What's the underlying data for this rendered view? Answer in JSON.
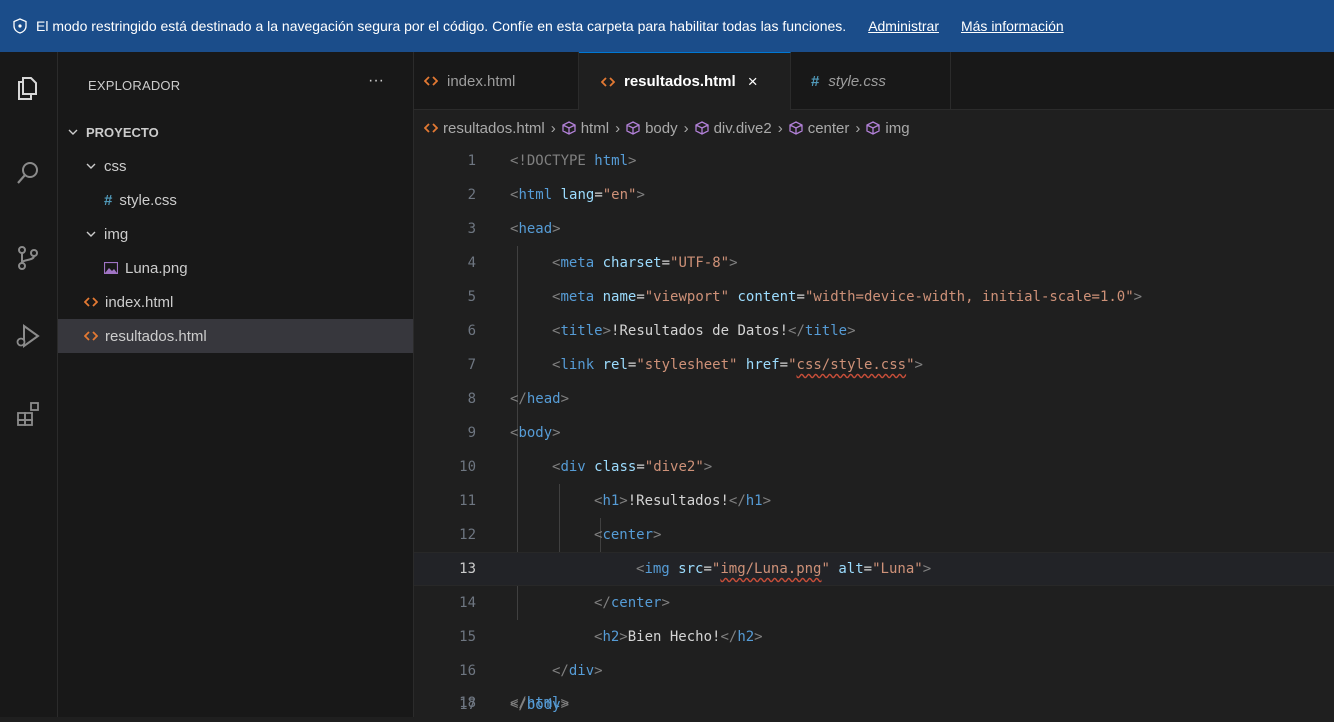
{
  "banner": {
    "message": "El modo restringido está destinado a la navegación segura por el código. Confíe en esta carpeta para habilitar todas las funciones.",
    "manage_label": "Administrar",
    "more_info_label": "Más información"
  },
  "sidebar": {
    "title": "EXPLORADOR",
    "more": "···",
    "project": "PROYECTO",
    "items": [
      {
        "label": "css"
      },
      {
        "label": "style.css"
      },
      {
        "label": "img"
      },
      {
        "label": "Luna.png"
      },
      {
        "label": "index.html"
      },
      {
        "label": "resultados.html"
      }
    ]
  },
  "tabs": [
    {
      "label": "index.html"
    },
    {
      "label": "resultados.html",
      "close": "×"
    },
    {
      "label": "style.css"
    }
  ],
  "breadcrumb": [
    "resultados.html",
    "html",
    "body",
    "div.dive2",
    "center",
    "img"
  ],
  "editor": {
    "current_line": 13,
    "lines": [
      {
        "n": "1"
      },
      {
        "n": "2"
      },
      {
        "n": "3"
      },
      {
        "n": "4"
      },
      {
        "n": "5"
      },
      {
        "n": "6"
      },
      {
        "n": "7"
      },
      {
        "n": "8"
      },
      {
        "n": "9"
      },
      {
        "n": "10"
      },
      {
        "n": "11"
      },
      {
        "n": "12"
      },
      {
        "n": "13"
      },
      {
        "n": "14"
      },
      {
        "n": "15"
      },
      {
        "n": "16"
      },
      {
        "n": "17"
      },
      {
        "n": "18"
      }
    ],
    "code": {
      "l1": [
        "<!DOCTYPE ",
        "html",
        ">"
      ],
      "l2": [
        "<",
        "html",
        " ",
        "lang",
        "=",
        "\"en\"",
        ">"
      ],
      "l3": [
        "<",
        "head",
        ">"
      ],
      "l4": [
        "<",
        "meta",
        " ",
        "charset",
        "=",
        "\"UTF-8\"",
        ">"
      ],
      "l5": [
        "<",
        "meta",
        " ",
        "name",
        "=",
        "\"viewport\"",
        " ",
        "content",
        "=",
        "\"width=device-width, initial-scale=1.0\"",
        ">"
      ],
      "l6": [
        "<",
        "title",
        ">",
        "!Resultados de Datos!",
        "</",
        "title",
        ">"
      ],
      "l7": [
        "<",
        "link",
        " ",
        "rel",
        "=",
        "\"stylesheet\"",
        " ",
        "href",
        "=",
        "\"",
        "css/style.css",
        "\"",
        ">"
      ],
      "l8": [
        "</",
        "head",
        ">"
      ],
      "l9": [
        "<",
        "body",
        ">"
      ],
      "l10": [
        "<",
        "div",
        " ",
        "class",
        "=",
        "\"dive2\"",
        ">"
      ],
      "l11": [
        "<",
        "h1",
        ">",
        "!Resultados!",
        "</",
        "h1",
        ">"
      ],
      "l12": [
        "<",
        "center",
        ">"
      ],
      "l13": [
        "<",
        "img",
        " ",
        "src",
        "=",
        "\"",
        "img/Luna.png",
        "\"",
        " ",
        "alt",
        "=",
        "\"Luna\"",
        ">"
      ],
      "l14": [
        "</",
        "center",
        ">"
      ],
      "l15": [
        "<",
        "h2",
        ">",
        "Bien Hecho!",
        "</",
        "h2",
        ">"
      ],
      "l16": [
        "</",
        "div",
        ">"
      ],
      "l17": [
        "</",
        "body",
        ">"
      ],
      "l18": [
        "</",
        "html",
        ">"
      ]
    }
  },
  "colors": {
    "banner_bg": "#1b4d8a",
    "tag_blue": "#569cd6",
    "attr": "#9cdcfe",
    "string": "#ce9178",
    "html_file_icon": "#e37933",
    "css_file_icon": "#519aba",
    "image_icon": "#a074c4"
  }
}
